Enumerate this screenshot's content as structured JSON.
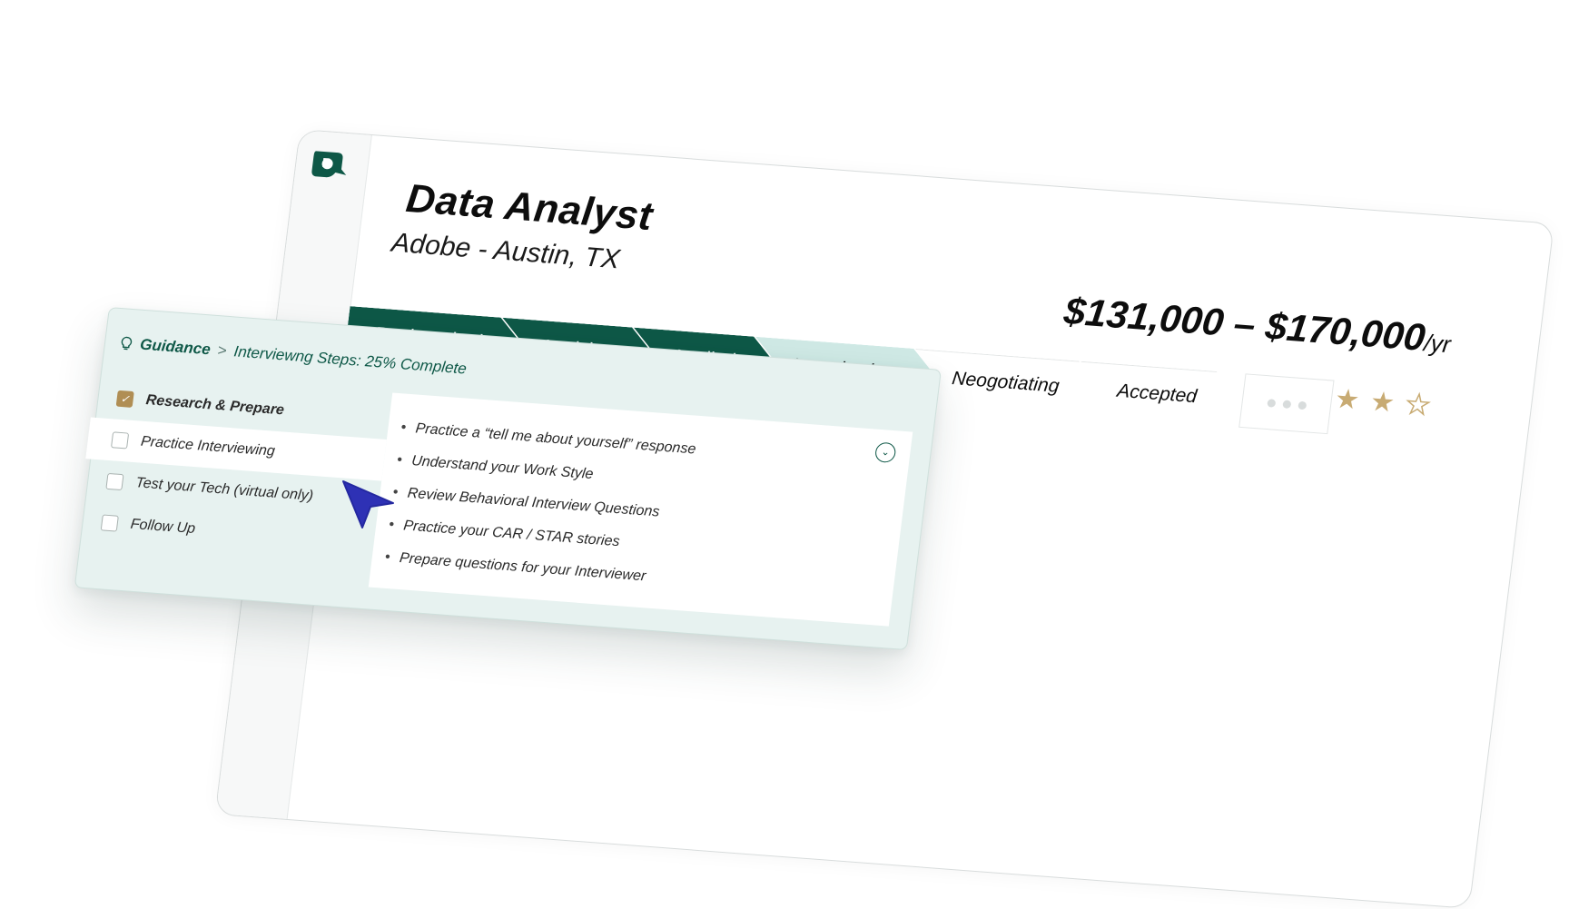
{
  "job": {
    "title": "Data Analyst",
    "company_location": "Adobe - Austin, TX",
    "salary_range": "$131,000 – $170,000",
    "salary_period": "/yr",
    "rating": {
      "value": 4,
      "max": 5
    }
  },
  "pipeline": {
    "stages": [
      {
        "label": "Bookmarked",
        "state": "done"
      },
      {
        "label": "Applying",
        "state": "done"
      },
      {
        "label": "Applied",
        "state": "done"
      },
      {
        "label": "Interviewing",
        "state": "current"
      },
      {
        "label": "Neogotiating",
        "state": "todo"
      },
      {
        "label": "Accepted",
        "state": "todo"
      }
    ],
    "more_icon": "more-dots-icon"
  },
  "guidance": {
    "label": "Guidance",
    "separator": ">",
    "progress_text": "Interviewng Steps: 25% Complete",
    "steps": [
      {
        "label": "Research & Prepare",
        "checked": true
      },
      {
        "label": "Practice Interviewing",
        "checked": false
      },
      {
        "label": "Test your Tech (virtual only)",
        "checked": false
      },
      {
        "label": "Follow Up",
        "checked": false
      }
    ],
    "details": [
      "Practice a “tell me about yourself” response",
      "Understand your Work Style",
      "Review Behavioral Interview Questions",
      "Practice your CAR / STAR stories",
      "Prepare questions for your Interviewer"
    ]
  },
  "colors": {
    "brand_green": "#0e5847",
    "current_stage": "#cfe9e5",
    "gold": "#c8ab73",
    "cursor": "#2e31b5"
  }
}
